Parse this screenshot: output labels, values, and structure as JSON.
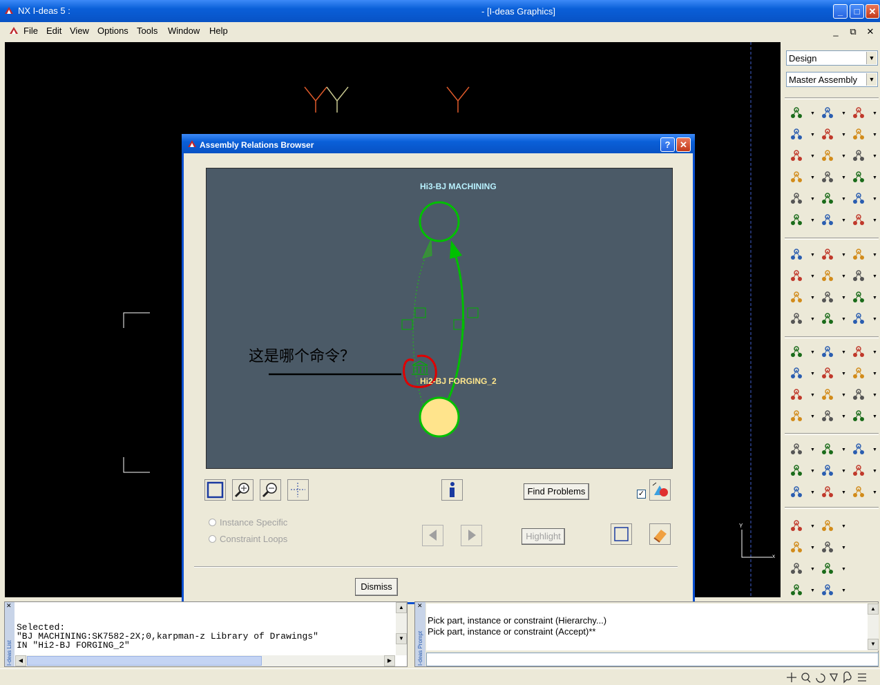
{
  "window": {
    "app_title": "NX I-deas 5 :",
    "doc_title": "- [I-deas Graphics]",
    "controls": {
      "minimize": "_",
      "maximize": "□",
      "close": "✕"
    }
  },
  "menu": {
    "items": [
      "File",
      "Edit",
      "View",
      "Options",
      "Tools",
      "Window",
      "Help"
    ],
    "mdi_controls": {
      "minimize": "_",
      "restore": "⧉",
      "close": "✕"
    }
  },
  "right_panel": {
    "task_combo": "Design",
    "assembly_combo": "Master Assembly"
  },
  "dialog": {
    "title": "Assembly Relations Browser",
    "help_button": "?",
    "close_button": "✕",
    "top_node_label": "Hi3-BJ MACHINING",
    "bottom_node_label": "Hi2-BJ FORGING_2",
    "annotation": "这是哪个命令？",
    "find_problems": "Find Problems",
    "highlight": "Highlight",
    "radio_instance": "Instance Specific",
    "radio_loops": "Constraint Loops",
    "dismiss": "Dismiss",
    "checkbox_checked": true,
    "colors": {
      "canvas_bg": "#4b5a67",
      "node_stroke": "#00c000",
      "top_label": "#b9f2ff",
      "bottom_label": "#ffe68c",
      "bottom_fill": "#ffe48c",
      "annotation_circle": "#e00000"
    }
  },
  "list_panel": {
    "side_label": "I-deas List",
    "text": "Selected:\n\"BJ MACHINING:SK7582-2X;0,karpman-z Library of Drawings\"\nIN \"Hi2-BJ FORGING_2\""
  },
  "prompt_panel": {
    "side_label": "I-deas Prompt",
    "line1": "Pick part, instance or constraint (Hierarchy...)",
    "line2": "Pick part, instance or constraint (Accept)**"
  },
  "graphics": {
    "triad_y": "Y",
    "triad_x": "x"
  }
}
